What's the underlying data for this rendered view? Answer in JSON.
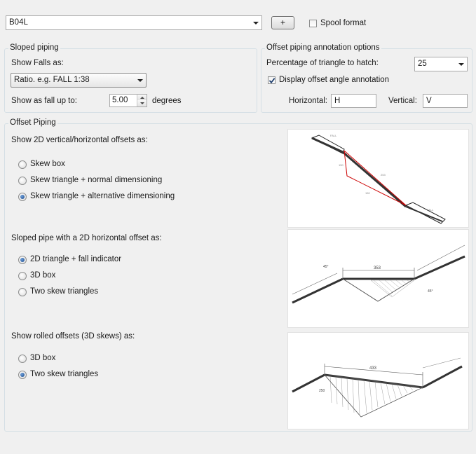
{
  "top": {
    "spec_value": "B04L",
    "add_label": "+",
    "spool_label": "Spool format",
    "spool_checked": false
  },
  "sloped": {
    "title": "Sloped piping",
    "show_falls_label": "Show Falls as:",
    "show_falls_value": "Ratio. e.g. FALL 1:38",
    "fall_up_label": "Show as fall up to:",
    "fall_up_value": "5.00",
    "degrees_label": "degrees"
  },
  "offset_annotation": {
    "title": "Offset piping annotation options",
    "percentage_label": "Percentage of triangle to hatch:",
    "percentage_value": "25",
    "display_angle_label": "Display offset angle annotation",
    "display_angle_checked": true,
    "horizontal_label": "Horizontal:",
    "horizontal_value": "H",
    "vertical_label": "Vertical:",
    "vertical_value": "V"
  },
  "offset_piping": {
    "title": "Offset Piping",
    "section1": {
      "label": "Show 2D vertical/horizontal offsets as:",
      "options": [
        "Skew box",
        "Skew triangle + normal dimensioning",
        "Skew triangle + alternative dimensioning"
      ],
      "selected": 2
    },
    "section2": {
      "label": "Sloped pipe with a 2D horizontal offset as:",
      "options": [
        "2D triangle + fall indicator",
        "3D box",
        "Two skew triangles"
      ],
      "selected": 0
    },
    "section3": {
      "label": "Show rolled offsets (3D skews) as:",
      "options": [
        "3D box",
        "Two skew triangles"
      ],
      "selected": 1
    }
  },
  "previews": {
    "img2": {
      "dim_top": "353",
      "angle_left": "45°",
      "angle_right": "45°"
    },
    "img3": {
      "dim_top": "433",
      "dim_side": "250"
    }
  }
}
